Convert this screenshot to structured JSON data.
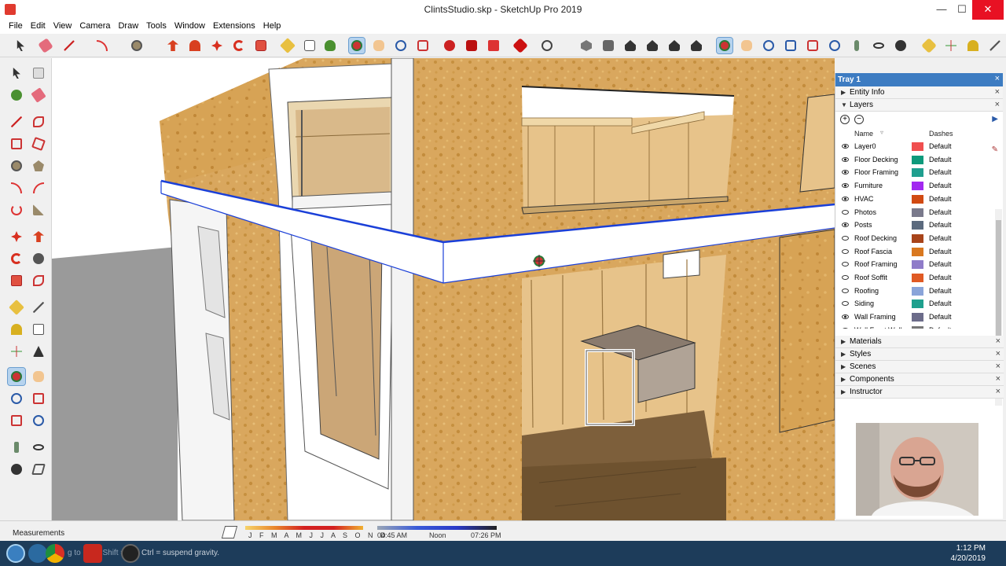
{
  "window": {
    "title": "ClintsStudio.skp - SketchUp Pro 2019",
    "minimize": "—",
    "maximize": "☐",
    "close": "✕"
  },
  "menu": [
    "File",
    "Edit",
    "View",
    "Camera",
    "Draw",
    "Tools",
    "Window",
    "Extensions",
    "Help"
  ],
  "tray": {
    "title": "Tray 1",
    "close": "×",
    "panels_top": [
      {
        "label": "Entity Info",
        "arrow": "▶"
      },
      {
        "label": "Layers",
        "arrow": "▼"
      }
    ],
    "layers": {
      "add": "+",
      "remove": "−",
      "details": "▶",
      "col_name": "Name",
      "col_dashes": "Dashes",
      "items": [
        {
          "name": "Layer0",
          "color": "#f04f4f",
          "dashes": "Default",
          "visible": true
        },
        {
          "name": "Floor Decking",
          "color": "#0e9a7c",
          "dashes": "Default",
          "visible": true
        },
        {
          "name": "Floor Framing",
          "color": "#1f9f8f",
          "dashes": "Default",
          "visible": true
        },
        {
          "name": "Furniture",
          "color": "#a228f0",
          "dashes": "Default",
          "visible": true
        },
        {
          "name": "HVAC",
          "color": "#d14a12",
          "dashes": "Default",
          "visible": true
        },
        {
          "name": "Photos",
          "color": "#7a7a8c",
          "dashes": "Default",
          "visible": false
        },
        {
          "name": "Posts",
          "color": "#5b6a7e",
          "dashes": "Default",
          "visible": true
        },
        {
          "name": "Roof Decking",
          "color": "#a8441a",
          "dashes": "Default",
          "visible": false
        },
        {
          "name": "Roof Fascia",
          "color": "#d9781f",
          "dashes": "Default",
          "visible": false
        },
        {
          "name": "Roof Framing",
          "color": "#8f7cc9",
          "dashes": "Default",
          "visible": false
        },
        {
          "name": "Roof Soffit",
          "color": "#e05a24",
          "dashes": "Default",
          "visible": false
        },
        {
          "name": "Roofing",
          "color": "#8aa4d9",
          "dashes": "Default",
          "visible": false
        },
        {
          "name": "Siding",
          "color": "#1fa08e",
          "dashes": "Default",
          "visible": false
        },
        {
          "name": "Wall Framing",
          "color": "#6c6c8a",
          "dashes": "Default",
          "visible": true
        },
        {
          "name": "Wall Front Wall",
          "color": "#777777",
          "dashes": "Default",
          "visible": false
        }
      ]
    },
    "panels_bottom": [
      {
        "label": "Materials",
        "arrow": "▶"
      },
      {
        "label": "Styles",
        "arrow": "▶"
      },
      {
        "label": "Scenes",
        "arrow": "▶"
      },
      {
        "label": "Components",
        "arrow": "▶"
      },
      {
        "label": "Instructor",
        "arrow": "▶"
      }
    ]
  },
  "status": {
    "measurements_label": "Measurements",
    "months": "J F M A M J J A S O N D",
    "sunrise": "04:45 AM",
    "noon": "Noon",
    "sunset": "07:26 PM",
    "hint": "Ctrl = suspend gravity.",
    "hint_ghost": "g to orbit, Shift ="
  },
  "clock": {
    "time": "1:12 PM",
    "date": "4/20/2019"
  },
  "colors": {
    "accent": "#3d7cc2",
    "selection_blue": "#1a3fd8",
    "osb": "#d9a75e",
    "osb_dark": "#c79143",
    "stud": "#e7c38a",
    "floor": "#7d5f3b",
    "gray_ground": "#9a9a9a"
  }
}
